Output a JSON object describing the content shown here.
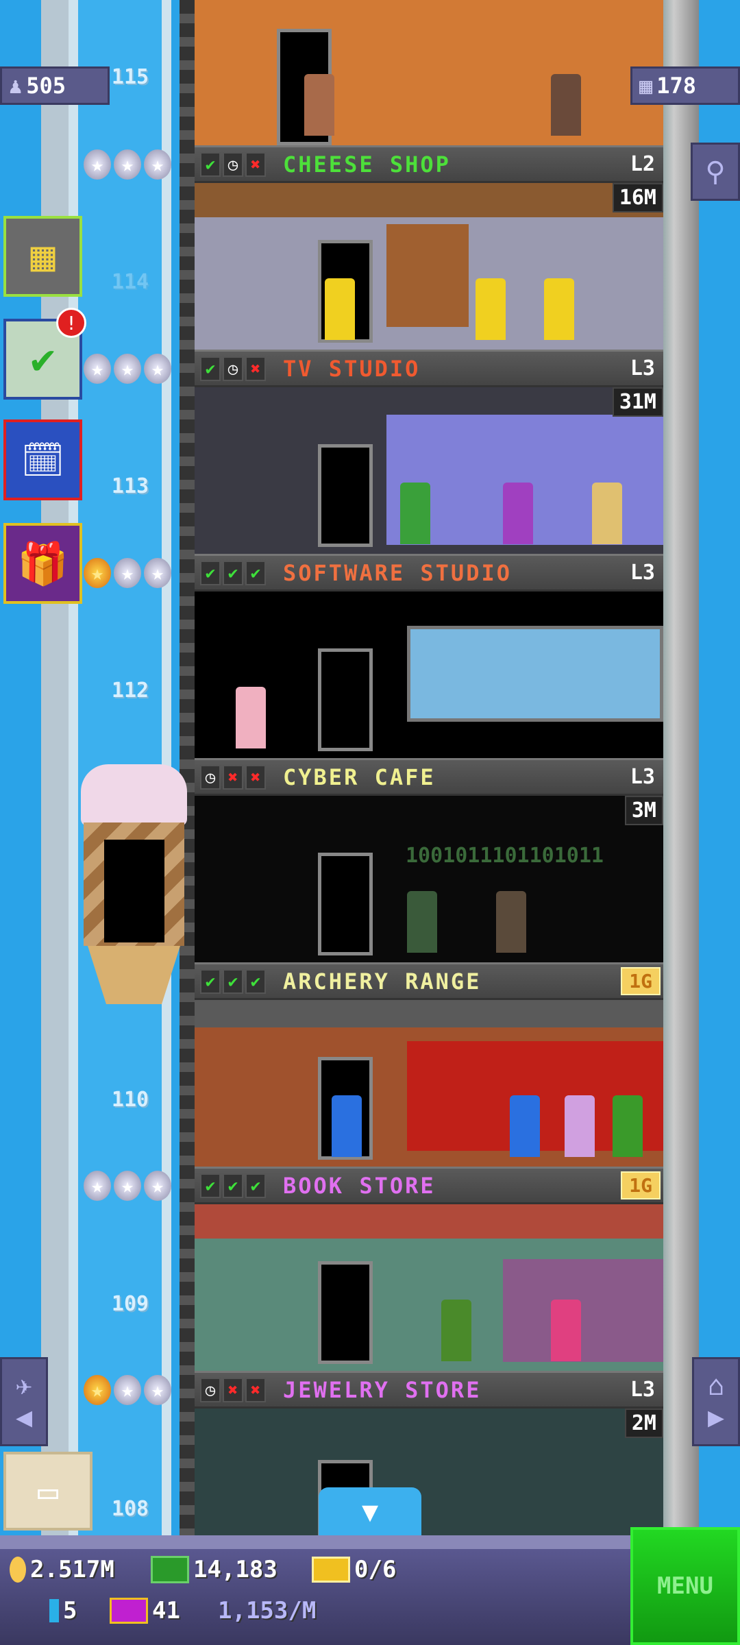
{
  "top": {
    "population": "505",
    "population_icon": "person-icon",
    "floors": "178",
    "floors_icon": "building-icon"
  },
  "floor_numbers": [
    "115",
    "114",
    "113",
    "112",
    "110",
    "109",
    "108"
  ],
  "floors": [
    {
      "name": "CHEESE SHOP",
      "color": "#4de03a",
      "status": [
        "check",
        "clock",
        "x"
      ],
      "level": "L2",
      "cost": "16M",
      "stars": [
        "silver",
        "silver",
        "silver"
      ]
    },
    {
      "name": "TV STUDIO",
      "color": "#f05a30",
      "status": [
        "check",
        "clock",
        "x"
      ],
      "level": "L3",
      "cost": "31M",
      "stars": [
        "silver",
        "silver",
        "silver"
      ]
    },
    {
      "name": "SOFTWARE STUDIO",
      "color": "#f07040",
      "status": [
        "check",
        "check",
        "check"
      ],
      "level": "L3",
      "cost": "",
      "stars": [
        "gold",
        "silver",
        "silver"
      ]
    },
    {
      "name": "CYBER CAFE",
      "color": "#f0f090",
      "status": [
        "clock",
        "x",
        "x"
      ],
      "level": "L3",
      "cost": "3M",
      "stars": []
    },
    {
      "name": "ARCHERY RANGE",
      "color": "#f0f0a0",
      "status": [
        "check",
        "check",
        "check"
      ],
      "level": "",
      "gold": "1G",
      "stars": []
    },
    {
      "name": "BOOK STORE",
      "color": "#e070f0",
      "status": [
        "check",
        "check",
        "check"
      ],
      "level": "",
      "gold": "1G",
      "stars": [
        "silver",
        "silver",
        "silver"
      ]
    },
    {
      "name": "JEWELRY STORE",
      "color": "#e070f0",
      "status": [
        "clock",
        "x",
        "x"
      ],
      "level": "L3",
      "cost": "2M",
      "stars": [
        "gold",
        "silver",
        "silver"
      ]
    }
  ],
  "cyber_cafe_screen": "1001011101101011",
  "bottom": {
    "coins": "2.517M",
    "bux": "14,183",
    "golden_tickets": "0/6",
    "batteries": "5",
    "tickets": "41",
    "income": "1,153/M",
    "menu": "MENU"
  },
  "icons": {
    "status_check": "✔",
    "status_clock": "◷",
    "status_x": "✖",
    "star": "★"
  }
}
